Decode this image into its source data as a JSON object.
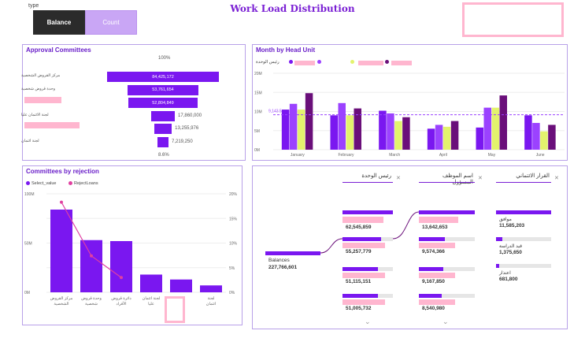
{
  "slicer": {
    "label": "type",
    "options": [
      "Balance",
      "Count"
    ],
    "selected": "Balance"
  },
  "title": "Work Load Distribution",
  "approval": {
    "title": "Approval Committees",
    "top_pct": "100%",
    "bottom_pct": "8.6%",
    "rows": [
      {
        "label": "مركز القروض الشخصية",
        "value": "84,425,172",
        "v": 84425172
      },
      {
        "label": "وحدة قروض شخصية",
        "value": "53,761,654",
        "v": 53761654
      },
      {
        "label": "",
        "value": "52,804,849",
        "v": 52804849
      },
      {
        "label": "لجنة الائتمان عليا",
        "value": "17,860,000",
        "v": 17860000
      },
      {
        "label": "",
        "value": "13,255,976",
        "v": 13255976
      },
      {
        "label": "لجنة ائتمان",
        "value": "7,219,250",
        "v": 7219250
      }
    ]
  },
  "month_chart": {
    "title": "Month by Head Unit",
    "legend_title": "رئيس الوحدة",
    "ref_value": "9,143.5",
    "y_ticks": [
      "20M",
      "15M",
      "10M",
      "5M",
      "0M"
    ],
    "chart_data": {
      "type": "bar",
      "categories": [
        "January",
        "February",
        "March",
        "April",
        "May",
        "June"
      ],
      "ylim": [
        0,
        20
      ],
      "series": [
        {
          "color": "#7a17f0",
          "values": [
            10.5,
            9.0,
            10.2,
            5.5,
            5.8,
            9.0
          ]
        },
        {
          "color": "#9b42ff",
          "values": [
            12.0,
            12.2,
            9.5,
            6.5,
            11.0,
            7.0
          ]
        },
        {
          "color": "#e3f36d",
          "values": [
            10.5,
            9.0,
            7.5,
            6.0,
            11.0,
            4.8
          ]
        },
        {
          "color": "#6a0f7a",
          "values": [
            14.8,
            10.8,
            8.5,
            7.5,
            14.2,
            6.5
          ]
        }
      ]
    }
  },
  "rejection": {
    "title": "Committees by rejection",
    "legend": [
      "Select_value",
      "RejectLoans"
    ],
    "y_left": [
      "100M",
      "50M",
      "0M"
    ],
    "y_right": [
      "20%",
      "15%",
      "10%",
      "5%",
      "0%"
    ],
    "chart_data": {
      "type": "bar",
      "categories": [
        "مركز القروض الشخصية",
        "وحدة قروض شخصية",
        "دائرة قروض الأفراد",
        "لجنة ائتمان عليا",
        "",
        "لجنة ائتمان"
      ],
      "ylim": [
        0,
        100
      ],
      "series": [
        {
          "name": "Select_value",
          "values": [
            84,
            53,
            52,
            18,
            13,
            7
          ]
        },
        {
          "name": "RejectLoans",
          "values": [
            18.3,
            7.4,
            3.0,
            null,
            null,
            null
          ]
        }
      ],
      "y2lim": [
        0,
        20
      ]
    }
  },
  "decomp": {
    "columns": [
      "رئيس الوحدة",
      "اسم الموظف المسؤول",
      "القرار الائتماني"
    ],
    "root_label": "Balances",
    "root_value": "227,766,601",
    "col1": [
      {
        "value": "",
        "frac": 1.0
      },
      {
        "value": "62,545,859",
        "frac": 0.86
      },
      {
        "value": "55,257,779",
        "frac": 0.76
      },
      {
        "value": "51,115,151",
        "frac": 0.7
      },
      {
        "value": "51,005,732",
        "frac": 0.7
      }
    ],
    "col2": [
      {
        "value": "",
        "frac": 1.0
      },
      {
        "value": "13,642,653",
        "frac": 0.66
      },
      {
        "value": "9,574,366",
        "frac": 0.46
      },
      {
        "value": "9,167,850",
        "frac": 0.44
      },
      {
        "value": "8,540,980",
        "frac": 0.41
      }
    ],
    "col3": [
      {
        "label": "موافق",
        "value": "11,585,203",
        "frac": 1.0
      },
      {
        "label": "قيد الدراسة",
        "value": "1,375,650",
        "frac": 0.12
      },
      {
        "label": "اعتذار",
        "value": "681,800",
        "frac": 0.06
      }
    ]
  }
}
